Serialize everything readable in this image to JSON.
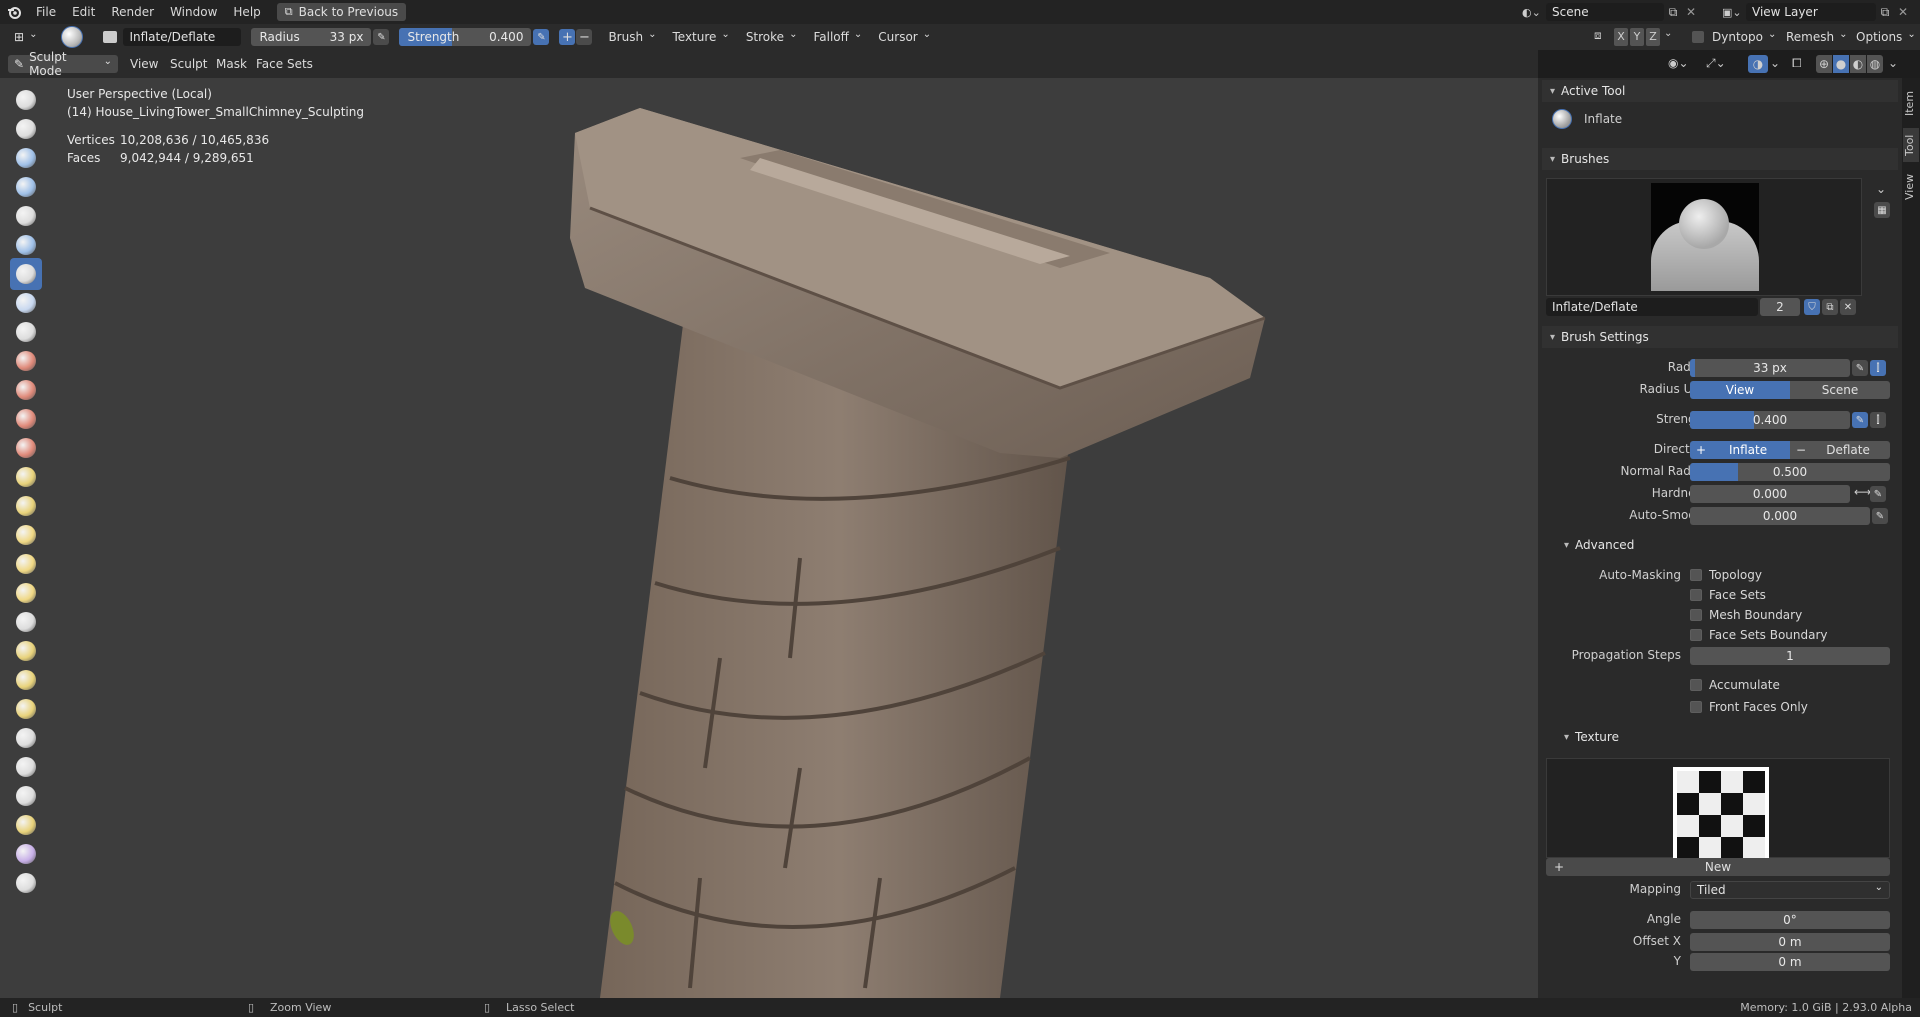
{
  "menu": {
    "items": [
      "File",
      "Edit",
      "Render",
      "Window",
      "Help"
    ],
    "back_label": "Back to Previous",
    "scene_label": "Scene",
    "view_layer_label": "View Layer"
  },
  "tool_header": {
    "brush_name": "Inflate/Deflate",
    "radius_label": "Radius",
    "radius_value": "33 px",
    "strength_label": "Strength",
    "strength_value": "0.400",
    "strength_fraction": 0.4,
    "menus": [
      "Brush",
      "Texture",
      "Stroke",
      "Falloff",
      "Cursor"
    ],
    "axes": [
      "X",
      "Y",
      "Z"
    ],
    "dyntopo_label": "Dyntopo",
    "remesh_label": "Remesh",
    "options_label": "Options"
  },
  "mode_header": {
    "mode_label": "Sculpt Mode",
    "menus": [
      "View",
      "Sculpt",
      "Mask",
      "Face Sets"
    ]
  },
  "viewport": {
    "perspective_label": "User Perspective (Local)",
    "object_label": "(14) House_LivingTower_SmallChimney_Sculpting",
    "vertices_label": "Vertices",
    "vertices_value": "10,208,636 / 10,465,836",
    "faces_label": "Faces",
    "faces_value": "9,042,944 / 9,289,651"
  },
  "side_tabs": [
    "Item",
    "Tool",
    "View"
  ],
  "panel": {
    "active_tool_header": "Active Tool",
    "active_tool_name": "Inflate",
    "brushes_header": "Brushes",
    "brush_datablock": "Inflate/Deflate",
    "brush_users": "2",
    "brush_settings_header": "Brush Settings",
    "radius_label": "Radius",
    "radius_value": "33 px",
    "radius_unit_label": "Radius Unit",
    "radius_unit_options": [
      "View",
      "Scene"
    ],
    "strength_label": "Strength",
    "strength_value": "0.400",
    "strength_fraction": 0.4,
    "direction_label": "Direction",
    "direction_options": [
      "Inflate",
      "Deflate"
    ],
    "normal_radius_label": "Normal Radius",
    "normal_radius_value": "0.500",
    "normal_radius_fraction": 0.5,
    "hardness_label": "Hardness",
    "hardness_value": "0.000",
    "auto_smooth_label": "Auto-Smooth",
    "auto_smooth_value": "0.000",
    "advanced_header": "Advanced",
    "auto_masking_label": "Auto-Masking",
    "masking_options": [
      "Topology",
      "Face Sets",
      "Mesh Boundary",
      "Face Sets Boundary"
    ],
    "propagation_label": "Propagation Steps",
    "propagation_value": "1",
    "accumulate_label": "Accumulate",
    "front_faces_label": "Front Faces Only",
    "texture_header": "Texture",
    "new_label": "New",
    "mapping_label": "Mapping",
    "mapping_value": "Tiled",
    "angle_label": "Angle",
    "angle_value": "0°",
    "offset_x_label": "Offset X",
    "offset_x_value": "0 m",
    "offset_y_label": "Y",
    "offset_y_value": "0 m"
  },
  "status_bar": {
    "left_label": "Sculpt",
    "middle_label": "Zoom View",
    "right_label": "Lasso Select",
    "memory_label": "Memory: 1.0 GiB | 2.93.0 Alpha"
  },
  "colors": {
    "accent": "#4772b3",
    "viewport_bg": "#3d3d3d",
    "panel_bg": "#2a2a2a",
    "clay": "#8a7a6c"
  },
  "toolbar_icons": [
    "draw-brush-icon",
    "draw-sharp-icon",
    "clay-icon",
    "clay-strips-icon",
    "clay-thumb-icon",
    "layer-icon",
    "inflate-icon",
    "blob-icon",
    "crease-icon",
    "smooth-icon",
    "flatten-icon",
    "fill-icon",
    "scrape-icon",
    "multiplane-scrape-icon",
    "pinch-icon",
    "grab-icon",
    "elastic-deform-icon",
    "snake-hook-icon",
    "thumb-icon",
    "pose-icon",
    "nudge-icon",
    "rotate-icon",
    "slide-relax-icon",
    "boundary-icon",
    "cloth-icon",
    "simplify-icon",
    "mask-icon",
    "draw-face-sets-icon"
  ]
}
